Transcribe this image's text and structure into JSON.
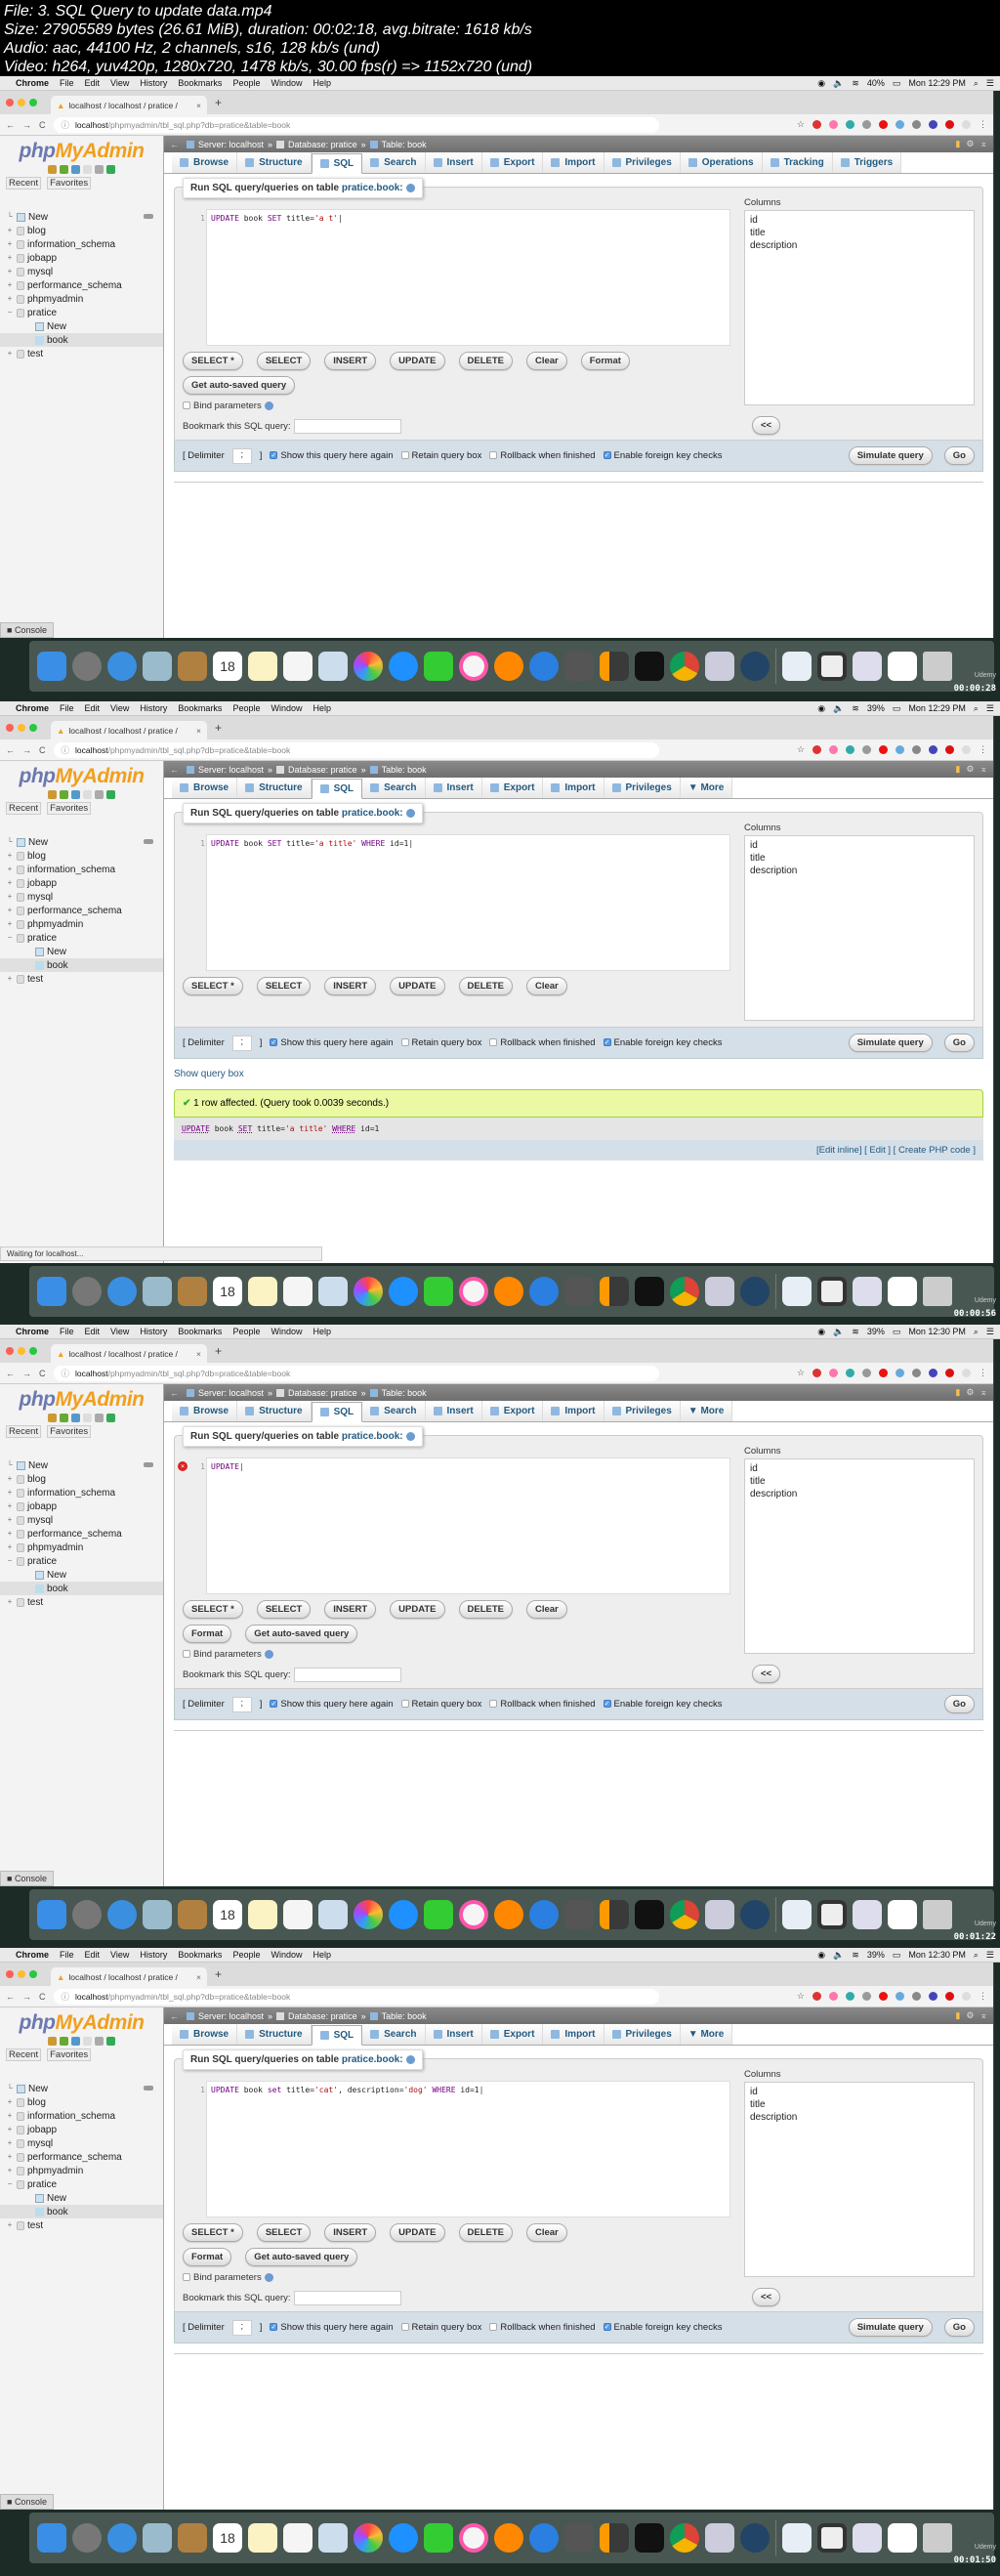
{
  "file_info": {
    "line1": "File: 3. SQL Query to update data.mp4",
    "line2": "Size: 27905589 bytes (26.61 MiB), duration: 00:02:18, avg.bitrate: 1618 kb/s",
    "line3": "Audio: aac, 44100 Hz, 2 channels, s16, 128 kb/s (und)",
    "line4": "Video: h264, yuv420p, 1280x720, 1478 kb/s, 30.00 fps(r) => 1152x720 (und)"
  },
  "menubar": {
    "apple": "",
    "app": "Chrome",
    "items": [
      "File",
      "Edit",
      "View",
      "History",
      "Bookmarks",
      "People",
      "Window",
      "Help"
    ]
  },
  "browser": {
    "tab_title": "localhost / localhost / pratice /",
    "tab_close": "×",
    "new_tab": "+",
    "url_host": "localhost",
    "url_path": "/phpmyadmin/tbl_sql.php?db=pratice&table=book",
    "back": "←",
    "forward": "→",
    "reload": "C",
    "star": "☆"
  },
  "pma": {
    "logo_php": "php",
    "logo_my": "MyAdmin",
    "recent": "Recent",
    "favorites": "Favorites",
    "tree": [
      {
        "label": "New",
        "type": "new"
      },
      {
        "label": "blog",
        "type": "db"
      },
      {
        "label": "information_schema",
        "type": "db"
      },
      {
        "label": "jobapp",
        "type": "db"
      },
      {
        "label": "mysql",
        "type": "db"
      },
      {
        "label": "performance_schema",
        "type": "db"
      },
      {
        "label": "phpmyadmin",
        "type": "db"
      },
      {
        "label": "pratice",
        "type": "db-open"
      },
      {
        "label": "New",
        "type": "child-new"
      },
      {
        "label": "book",
        "type": "child-table"
      },
      {
        "label": "test",
        "type": "db"
      }
    ],
    "breadcrumb": {
      "server": "Server: localhost",
      "database": "Database: pratice",
      "table": "Table: book",
      "sep": "»"
    },
    "tabs_full": [
      "Browse",
      "Structure",
      "SQL",
      "Search",
      "Insert",
      "Export",
      "Import",
      "Privileges",
      "Operations",
      "Tracking",
      "Triggers"
    ],
    "tabs_short": [
      "Browse",
      "Structure",
      "SQL",
      "Search",
      "Insert",
      "Export",
      "Import",
      "Privileges",
      "▼ More"
    ],
    "legend_prefix": "Run SQL query/queries on table ",
    "legend_table": "pratice.book:",
    "columns_label": "Columns",
    "columns": [
      "id",
      "title",
      "description"
    ],
    "buttons": {
      "select_star": "SELECT *",
      "select": "SELECT",
      "insert": "INSERT",
      "update": "UPDATE",
      "delete": "DELETE",
      "clear": "Clear",
      "format": "Format",
      "auto_saved": "Get auto-saved query",
      "insert_col": "<<",
      "simulate": "Simulate query",
      "go": "Go"
    },
    "bind_parameters": "Bind parameters",
    "bookmark_label": "Bookmark this SQL query:",
    "delimiter_label": "[ Delimiter",
    "delimiter_close": "]",
    "delimiter_value": ";",
    "options": {
      "show_again": "Show this query here again",
      "retain": "Retain query box",
      "rollback": "Rollback when finished",
      "fk_checks": "Enable foreign key checks"
    },
    "console": "Console"
  },
  "frames": [
    {
      "time": "Mon 12:29 PM",
      "battery": "40%",
      "timecode": "00:00:28",
      "line_number": "1",
      "query": {
        "kw1": "UPDATE",
        "t1": " book ",
        "kw2": "SET",
        "t2": " title=",
        "s1": "'a t'"
      },
      "options_checked": {
        "show_again": true,
        "retain": false,
        "rollback": false,
        "fk_checks": true
      }
    },
    {
      "time": "Mon 12:29 PM",
      "battery": "39%",
      "timecode": "00:00:56",
      "line_number": "1",
      "query": {
        "kw1": "UPDATE",
        "t1": " book ",
        "kw2": "SET",
        "t2": " title=",
        "s1": "'a title'",
        "t3": " ",
        "kw3": "WHERE",
        "t4": " id=1"
      },
      "show_query_box": "Show query box",
      "result_message": "1 row affected. (Query took 0.0039 seconds.)",
      "result_sql": {
        "kw1": "UPDATE",
        "t1": " book ",
        "kw2": "SET",
        "t2": " title=",
        "s1": "'a title'",
        "t3": " ",
        "kw3": "WHERE",
        "t4": " id=1"
      },
      "edit_links": "[Edit inline] [ Edit ] [ Create PHP code ]",
      "status_bar": "Waiting for localhost..."
    },
    {
      "time": "Mon 12:30 PM",
      "battery": "39%",
      "timecode": "00:01:22",
      "line_number": "1",
      "query": {
        "kw1": "UPDATE"
      },
      "error_marker": "×"
    },
    {
      "time": "Mon 12:30 PM",
      "battery": "39%",
      "timecode": "00:01:50",
      "line_number": "1",
      "query": {
        "kw1": "UPDATE",
        "t1": " book ",
        "kw2": "set",
        "t2": " title=",
        "s1": "'cat'",
        "t3": ", description=",
        "s2": "'dog'",
        "t4": " ",
        "kw3": "WHERE",
        "t5": " id=1"
      }
    }
  ],
  "dock": {
    "brand": "Udemy",
    "calendar_day": "18"
  }
}
